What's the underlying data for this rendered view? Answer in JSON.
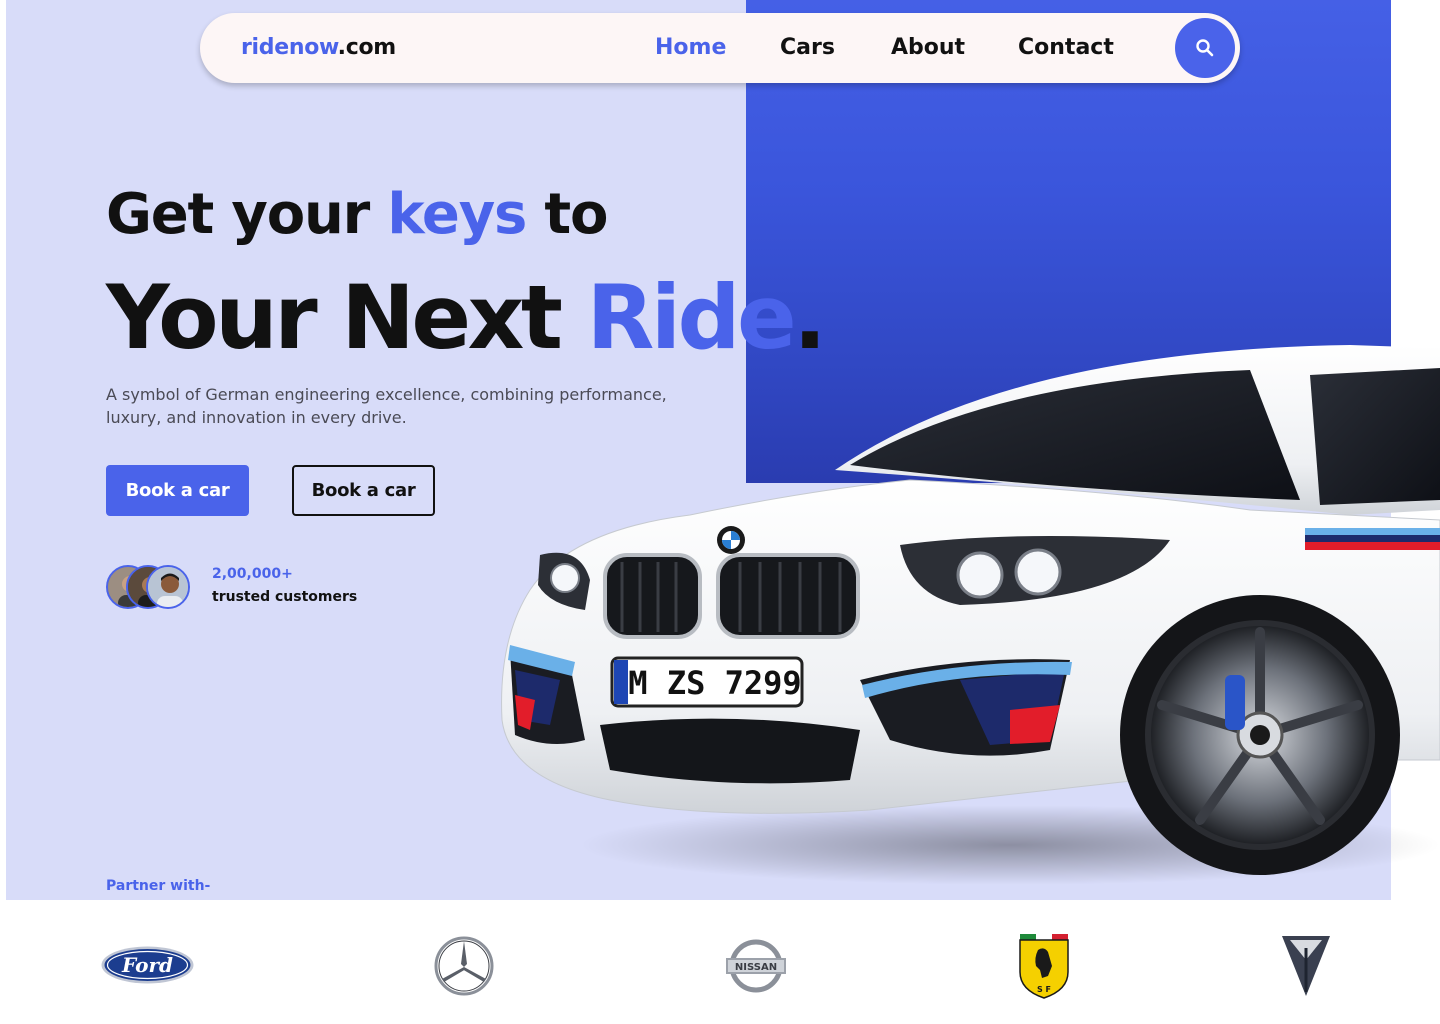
{
  "brand": {
    "name_accent": "ridenow",
    "name_rest": ".com"
  },
  "nav": {
    "items": [
      {
        "label": "Home",
        "active": true
      },
      {
        "label": "Cars",
        "active": false
      },
      {
        "label": "About",
        "active": false
      },
      {
        "label": "Contact",
        "active": false
      }
    ],
    "search_icon": "search-icon"
  },
  "hero": {
    "line1_before": "Get your ",
    "line1_accent": "keys",
    "line1_after": " to",
    "line2_before": "Your Next ",
    "line2_accent": "Ride",
    "line2_after": ".",
    "description": " A symbol of German engineering excellence, combining performance, luxury, and innovation in every drive.",
    "primary_button": "Book a car",
    "secondary_button": "Book a car",
    "customers_count": "2,00,000+",
    "customers_label": "trusted customers"
  },
  "car_plate": "M ZS 7299",
  "partners": {
    "label": "Partner with-",
    "brands": [
      "ford-logo",
      "mercedes-logo",
      "nissan-logo",
      "ferrari-logo",
      "tesla-logo"
    ]
  },
  "colors": {
    "accent": "#4a63ea",
    "hero_bg": "#d8dcf9",
    "panel": "#3a55db"
  }
}
